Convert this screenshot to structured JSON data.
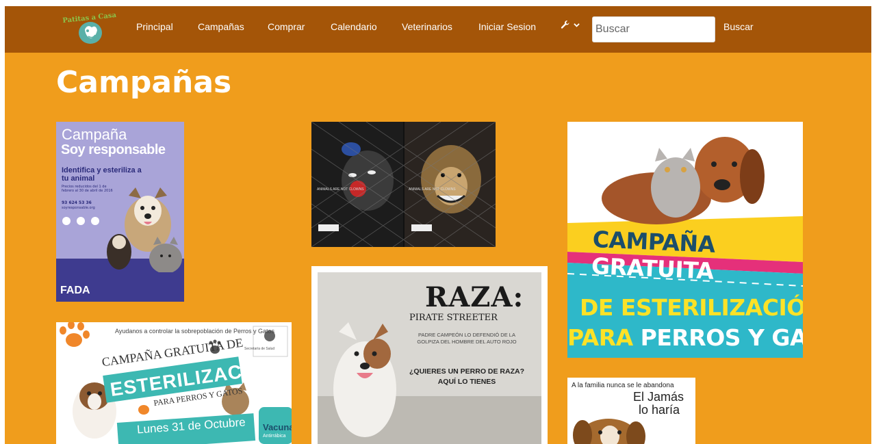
{
  "navbar": {
    "logo_text": "Patitas a Casa",
    "links": [
      {
        "id": "principal",
        "label": "Principal"
      },
      {
        "id": "campanas",
        "label": "Campañas"
      },
      {
        "id": "comprar",
        "label": "Comprar"
      },
      {
        "id": "calendario",
        "label": "Calendario"
      },
      {
        "id": "veterinarios",
        "label": "Veterinarios"
      },
      {
        "id": "iniciar-sesion",
        "label": "Iniciar Sesion"
      }
    ],
    "tools_icon": "wrench-icon",
    "search_placeholder": "Buscar",
    "search_button": "Buscar"
  },
  "page": {
    "title": "Campañas"
  },
  "posters": {
    "soy_responsable": {
      "line1": "Campaña",
      "line2": "Soy responsable",
      "line3": "Identifica y esteriliza a tu animal",
      "line4": "Precios reducidos del 1 de febrero al 30 de abril de 2016",
      "line5": "93 624 53 36",
      "line6": "soyresponsable.org",
      "footer": "FADA"
    },
    "circus": {
      "caption_left": "ANIMALS ARE NOT CLOWNS",
      "caption_right": "ANIMALS ARE NOT CLOWNS"
    },
    "esterilizacion_gratuita": {
      "line1_a": "CAMPAÑA",
      "line1_b": "GRATUITA",
      "line2": "DE ESTERILIZACIÓN",
      "line3_a": "PARA",
      "line3_b": "PERROS Y GATOS"
    },
    "lunes_31": {
      "header": "Ayudanos a controlar la sobrepoblación de Perros y Gatos",
      "line1": "CAMPAÑA GRATUITA DE",
      "line2": "ESTERILIZACIÓN",
      "line3": "PARA PERROS Y GATOS",
      "date_a": "Lunes 31",
      "date_b": "de Octubre",
      "vaccine_a": "Vacuna",
      "vaccine_b": "Antirrábica",
      "agency": "Secretaría de Salud"
    },
    "raza": {
      "title": "RAZA:",
      "subtitle": "PIRATE STREETER",
      "body": "PADRE CAMPEÓN LO DEFENDIÓ DE LA GOLPIZA DEL HOMBRE DEL AUTO ROJO",
      "question": "¿QUIERES UN PERRO DE RAZA? AQUÍ LO TIENES"
    },
    "jamas": {
      "line1": "A la familia nunca se le abandona",
      "line2": "El Jamás",
      "line3": "lo haría"
    }
  },
  "colors": {
    "page_bg": "#f09d1c",
    "navbar_bg": "#a45508",
    "text": "#ffffff"
  }
}
